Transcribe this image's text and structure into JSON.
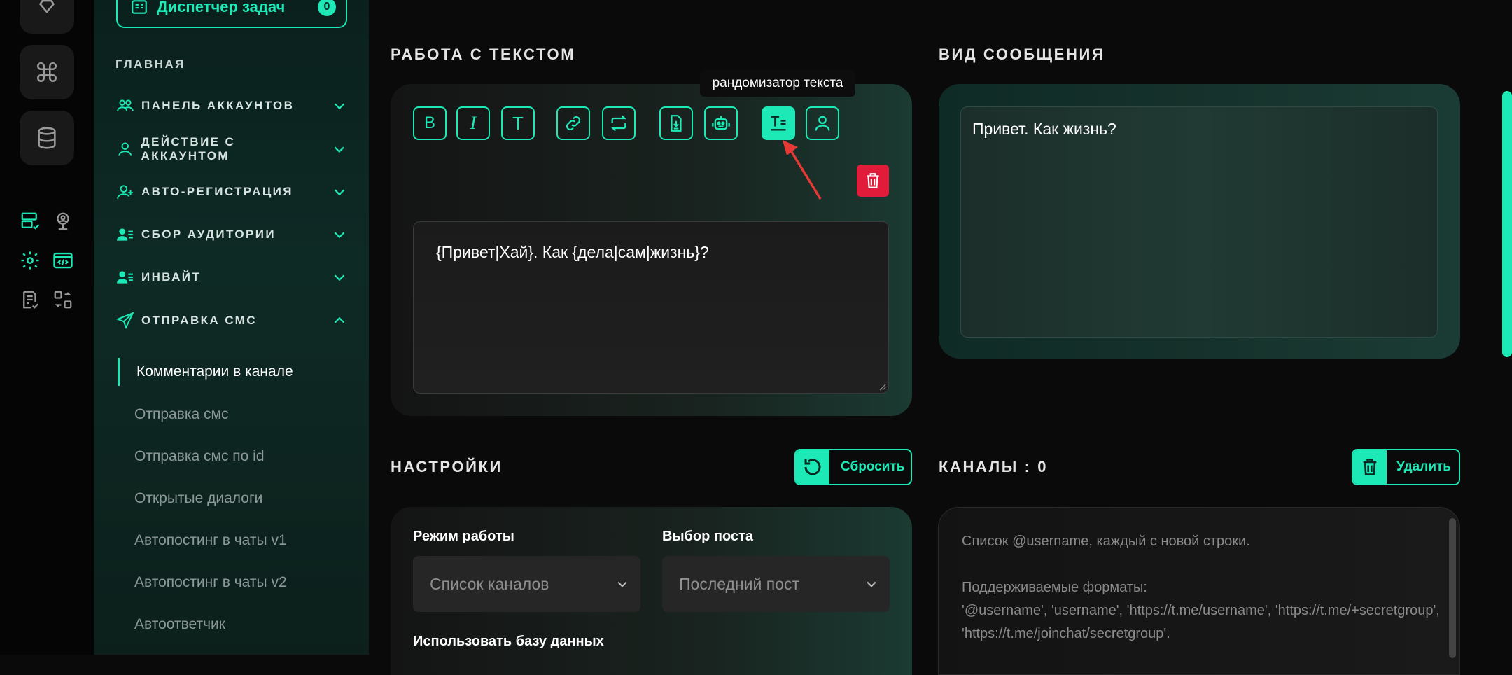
{
  "sidebar": {
    "task_manager_label": "Диспетчер задач",
    "task_manager_count": "0",
    "section_label": "ГЛАВНАЯ",
    "nav": [
      {
        "label": "ПАНЕЛЬ АККАУНТОВ",
        "icon": "users-icon",
        "expanded": false
      },
      {
        "label": "ДЕЙСТВИЕ С АККАУНТОМ",
        "icon": "user-icon",
        "expanded": false
      },
      {
        "label": "АВТО-РЕГИСТРАЦИЯ",
        "icon": "user-plus-icon",
        "expanded": false
      },
      {
        "label": "СБОР АУДИТОРИИ",
        "icon": "user-list-icon",
        "expanded": false
      },
      {
        "label": "ИНВАЙТ",
        "icon": "user-list-icon",
        "expanded": false
      },
      {
        "label": "ОТПРАВКА СМС",
        "icon": "send-icon",
        "expanded": true
      }
    ],
    "sub_items": [
      {
        "label": "Комментарии в канале",
        "active": true
      },
      {
        "label": "Отправка смс",
        "active": false
      },
      {
        "label": "Отправка смс по id",
        "active": false
      },
      {
        "label": "Открытые диалоги",
        "active": false
      },
      {
        "label": "Автопостинг в чаты v1",
        "active": false
      },
      {
        "label": "Автопостинг в чаты v2",
        "active": false
      },
      {
        "label": "Автоответчик",
        "active": false
      }
    ]
  },
  "text_work": {
    "title": "РАБОТА С ТЕКСТОМ",
    "tooltip": "рандомизатор текста",
    "tools": [
      "bold-icon",
      "italic-icon",
      "text-icon",
      "link-icon",
      "repeat-icon",
      "file-download-icon",
      "robot-icon",
      "text-randomizer-icon",
      "user-icon"
    ],
    "text_value": "{Привет|Хай}. Как {дела|сам|жизнь}?"
  },
  "message_view": {
    "title": "ВИД СООБЩЕНИЯ",
    "preview_text": "Привет. Как жизнь?"
  },
  "settings": {
    "title": "НАСТРОЙКИ",
    "reset_label": "Сбросить",
    "mode_label": "Режим работы",
    "mode_value": "Список каналов",
    "post_label": "Выбор поста",
    "post_value": "Последний пост",
    "db_label": "Использовать базу данных"
  },
  "channels": {
    "title": "КАНАЛЫ : 0",
    "delete_label": "Удалить",
    "placeholder_line1": "Список @username, каждый с новой строки.",
    "placeholder_line2": "Поддерживаемые форматы:",
    "placeholder_line3": "'@username', 'username', 'https://t.me/username', 'https://t.me/+secretgroup', 'https://t.me/joinchat/secretgroup'."
  },
  "colors": {
    "accent": "#1de9b6",
    "danger": "#e01c3a",
    "bg": "#0a0a0a"
  }
}
